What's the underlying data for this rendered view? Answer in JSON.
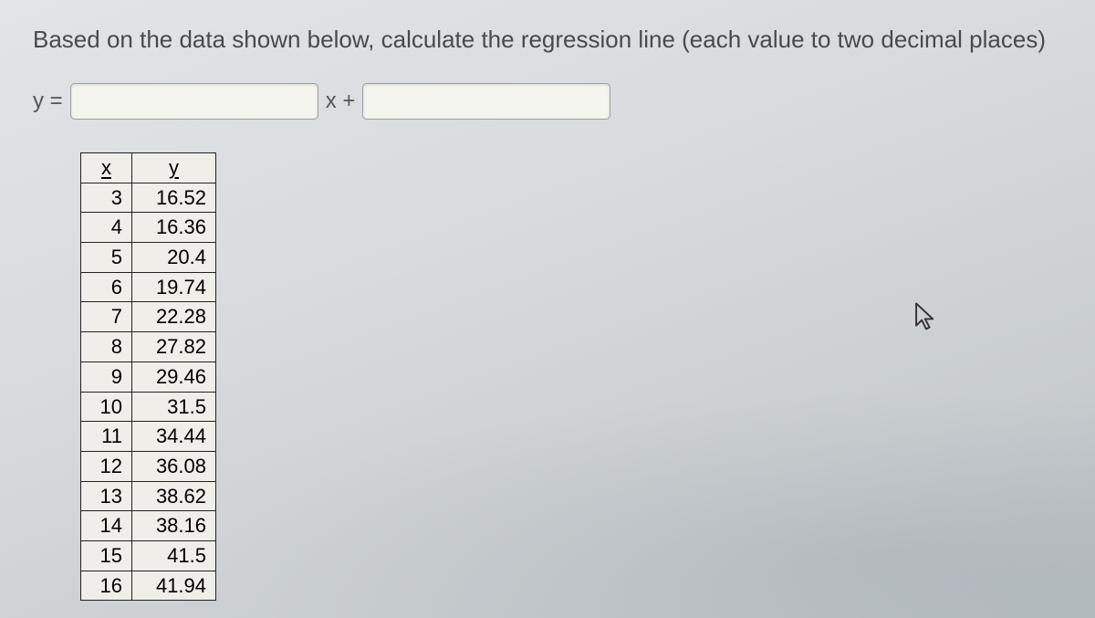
{
  "question": {
    "prompt": "Based on the data shown below, calculate the regression line (each value to two decimal places)"
  },
  "equation": {
    "y_equals": "y =",
    "x_plus": "x +",
    "slope_value": "",
    "intercept_value": ""
  },
  "table": {
    "header_x": "x",
    "header_y": "y",
    "rows": [
      {
        "x": "3",
        "y": "16.52"
      },
      {
        "x": "4",
        "y": "16.36"
      },
      {
        "x": "5",
        "y": "20.4"
      },
      {
        "x": "6",
        "y": "19.74"
      },
      {
        "x": "7",
        "y": "22.28"
      },
      {
        "x": "8",
        "y": "27.82"
      },
      {
        "x": "9",
        "y": "29.46"
      },
      {
        "x": "10",
        "y": "31.5"
      },
      {
        "x": "11",
        "y": "34.44"
      },
      {
        "x": "12",
        "y": "36.08"
      },
      {
        "x": "13",
        "y": "38.62"
      },
      {
        "x": "14",
        "y": "38.16"
      },
      {
        "x": "15",
        "y": "41.5"
      },
      {
        "x": "16",
        "y": "41.94"
      }
    ]
  },
  "chart_data": {
    "type": "table",
    "title": "xy data for linear regression",
    "columns": [
      "x",
      "y"
    ],
    "x": [
      3,
      4,
      5,
      6,
      7,
      8,
      9,
      10,
      11,
      12,
      13,
      14,
      15,
      16
    ],
    "y": [
      16.52,
      16.36,
      20.4,
      19.74,
      22.28,
      27.82,
      29.46,
      31.5,
      34.44,
      36.08,
      38.62,
      38.16,
      41.5,
      41.94
    ]
  }
}
